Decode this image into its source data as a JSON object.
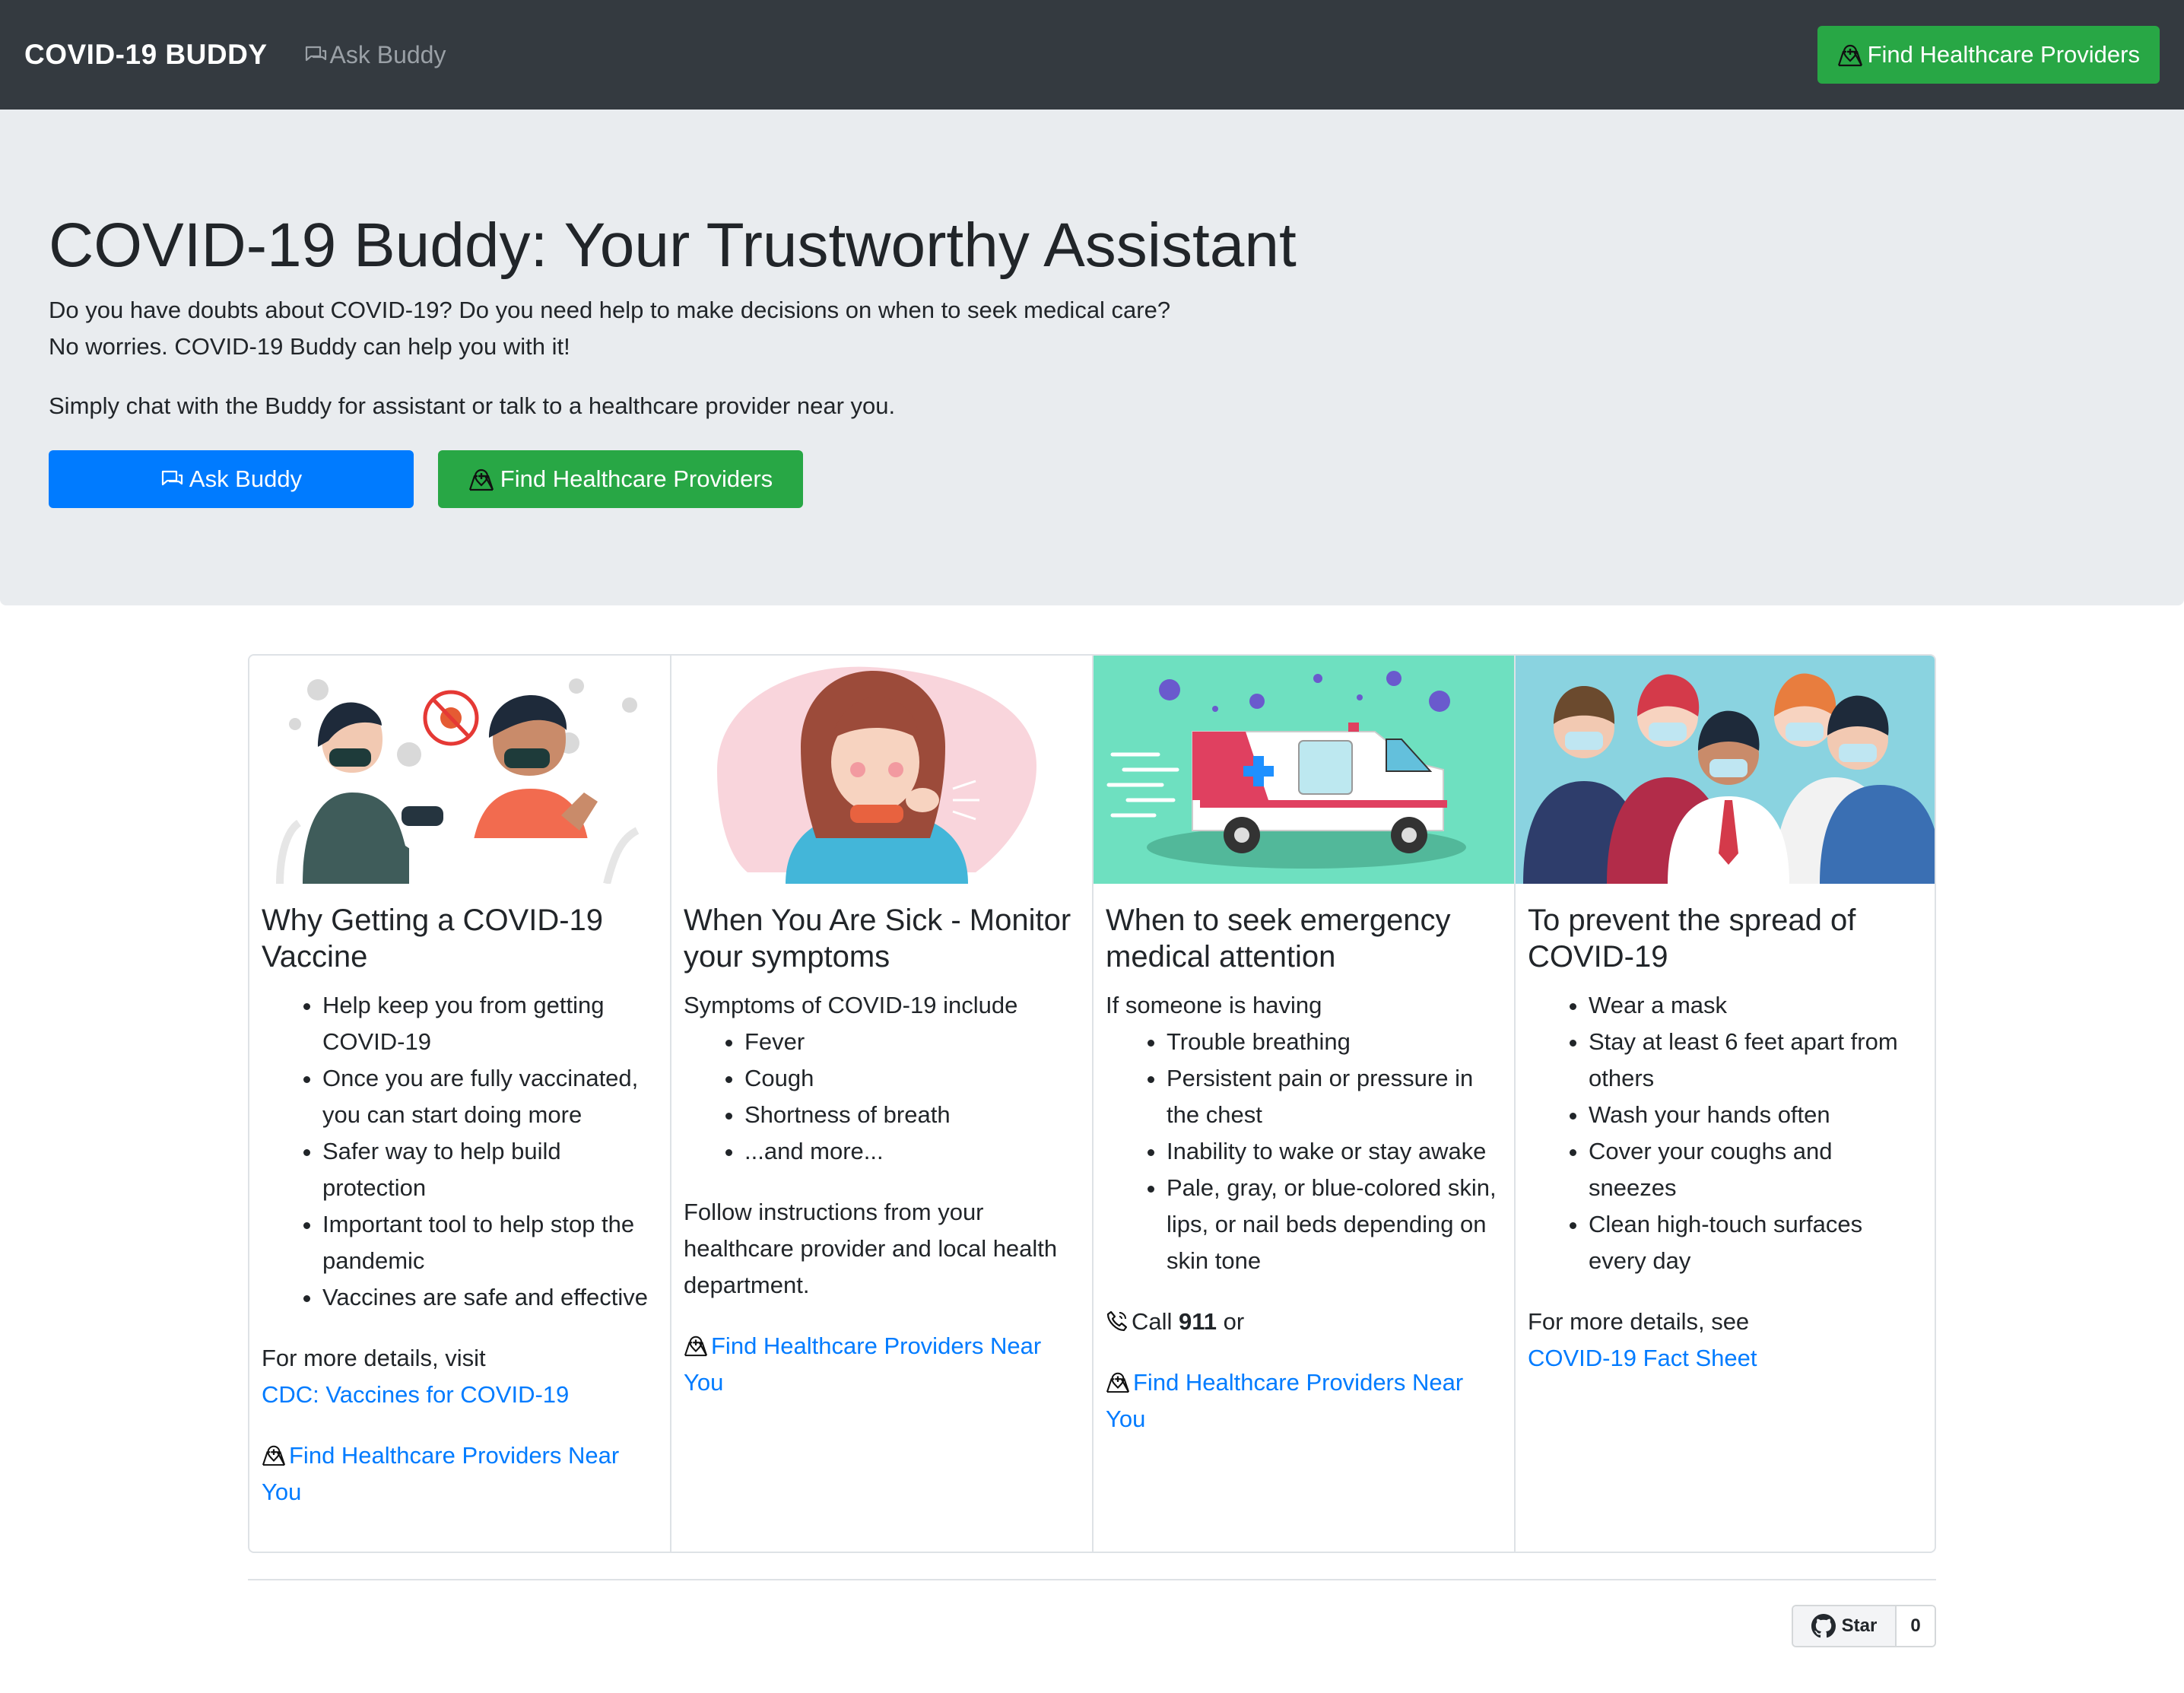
{
  "navbar": {
    "brand": "COVID-19 BUDDY",
    "ask_link": "Ask Buddy",
    "find_button": "Find Healthcare Providers"
  },
  "hero": {
    "title": "COVID-19 Buddy: Your Trustworthy Assistant",
    "line1": "Do you have doubts about COVID-19? Do you need help to make decisions on when to seek medical care?",
    "line2": "No worries. COVID-19 Buddy can help you with it!",
    "line3": "Simply chat with the Buddy for assistant or talk to a healthcare provider near you.",
    "ask_button": "Ask Buddy",
    "find_button": "Find Healthcare Providers"
  },
  "cards": [
    {
      "title": "Why Getting a COVID-19 Vaccine",
      "items": [
        "Help keep you from getting COVID-19",
        "Once you are fully vaccinated, you can start doing more",
        "Safer way to help build protection",
        "Important tool to help stop the pandemic",
        "Vaccines are safe and effective"
      ],
      "more_text": "For more details, visit",
      "more_link": "CDC: Vaccines for COVID-19",
      "find_link": "Find Healthcare Providers Near You"
    },
    {
      "title": "When You Are Sick - Monitor your symptoms",
      "intro": "Symptoms of COVID-19 include",
      "items": [
        "Fever",
        "Cough",
        "Shortness of breath",
        "...and more..."
      ],
      "follow": "Follow instructions from your healthcare provider and local health department.",
      "find_link": "Find Healthcare Providers Near You"
    },
    {
      "title": "When to seek emergency medical attention",
      "intro": "If someone is having",
      "items": [
        "Trouble breathing",
        "Persistent pain or pressure in the chest",
        "Inability to wake or stay awake",
        "Pale, gray, or blue-colored skin, lips, or nail beds depending on skin tone"
      ],
      "call_prefix": "Call",
      "call_number": "911",
      "call_suffix": "or",
      "find_link": "Find Healthcare Providers Near You",
      "ambulance_label": "AMBULANCE"
    },
    {
      "title": "To prevent the spread of COVID-19",
      "items": [
        "Wear a mask",
        "Stay at least 6 feet apart from others",
        "Wash your hands often",
        "Cover your coughs and sneezes",
        "Clean high-touch surfaces every day"
      ],
      "more_text": "For more details, see",
      "more_link": "COVID-19 Fact Sheet"
    }
  ],
  "github": {
    "star_label": "Star",
    "count": "0"
  },
  "colors": {
    "navbar": "#343a40",
    "primary": "#007bff",
    "success": "#28a745",
    "jumbotron": "#e9ecef"
  },
  "icons": [
    "chat-icon",
    "hospital-map-icon",
    "phone-icon",
    "github-icon"
  ]
}
